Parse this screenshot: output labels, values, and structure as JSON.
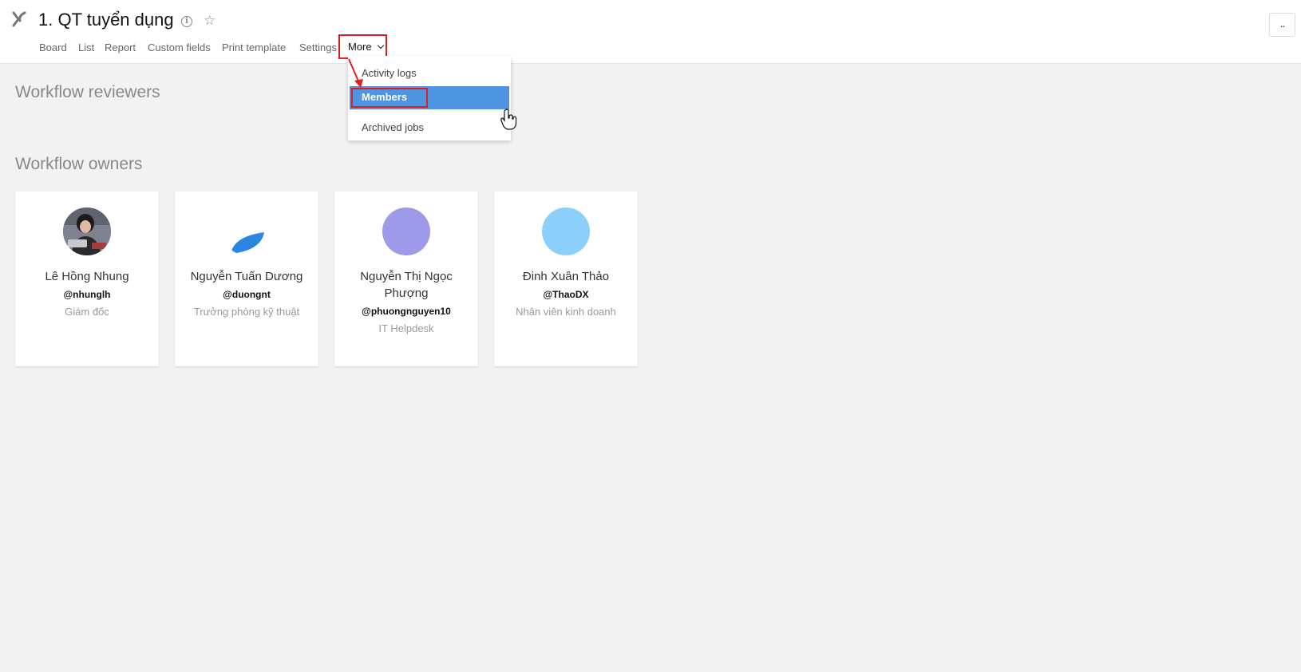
{
  "header": {
    "title": "1. QT tuyển dụng",
    "tabs": [
      "Board",
      "List",
      "Report",
      "Custom fields",
      "Print template",
      "Settings"
    ],
    "more_label": "More",
    "top_right_label": ".."
  },
  "dropdown": {
    "items": [
      "Activity logs",
      "Members",
      "Archived jobs"
    ],
    "active_index": 1
  },
  "sections": {
    "reviewers_heading": "Workflow reviewers",
    "owners_heading": "Workflow owners"
  },
  "owners": [
    {
      "name": "Lê Hồng Nhung",
      "handle": "@nhunglh",
      "role": "Giám đốc",
      "avatar": "photo"
    },
    {
      "name": "Nguyễn Tuấn Dương",
      "handle": "@duongnt",
      "role": "Trưởng phòng kỹ thuật",
      "avatar": "leaf-logo"
    },
    {
      "name": "Nguyễn Thị Ngọc Phượng",
      "handle": "@phuongnguyen10",
      "role": "IT Helpdesk",
      "avatar": "circle",
      "avatar_color": "#9e9aea"
    },
    {
      "name": "Đinh Xuân Thảo",
      "handle": "@ThaoDX",
      "role": "Nhân viên kinh doanh",
      "avatar": "circle",
      "avatar_color": "#8dcffb"
    }
  ],
  "colors": {
    "accent": "#4f94e0",
    "highlight_box": "#e01e1e",
    "leaf_logo": "#2a86e2"
  }
}
